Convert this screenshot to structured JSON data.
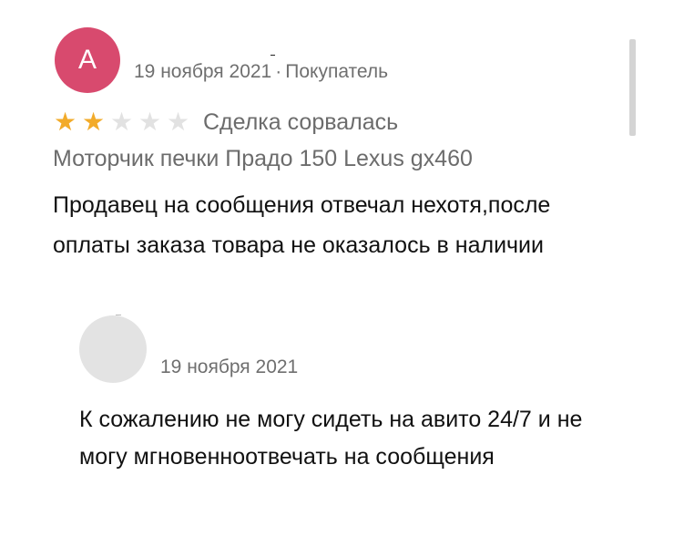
{
  "review": {
    "avatar_letter": "A",
    "avatar_color": "#d84a6e",
    "date": "19 ноября 2021",
    "separator": "·",
    "reviewer_role": "Покупатель",
    "rating": {
      "value": 2,
      "max": 5
    },
    "star_filled_color": "#f2ab2a",
    "star_empty_color": "#e2e2e2",
    "deal_status": "Сделка сорвалась",
    "product": "Моторчик печки Прадо 150 Lexus gx460",
    "text": "Продавец на сообщения отвечал нехотя,после оплаты заказа товара не оказалось в наличии"
  },
  "reply": {
    "avatar_color": "#e3e3e3",
    "date": "19 ноября 2021",
    "text": "К сожалению не могу сидеть на авито 24/7 и не могу мгновенноотвечать на сообщения"
  }
}
